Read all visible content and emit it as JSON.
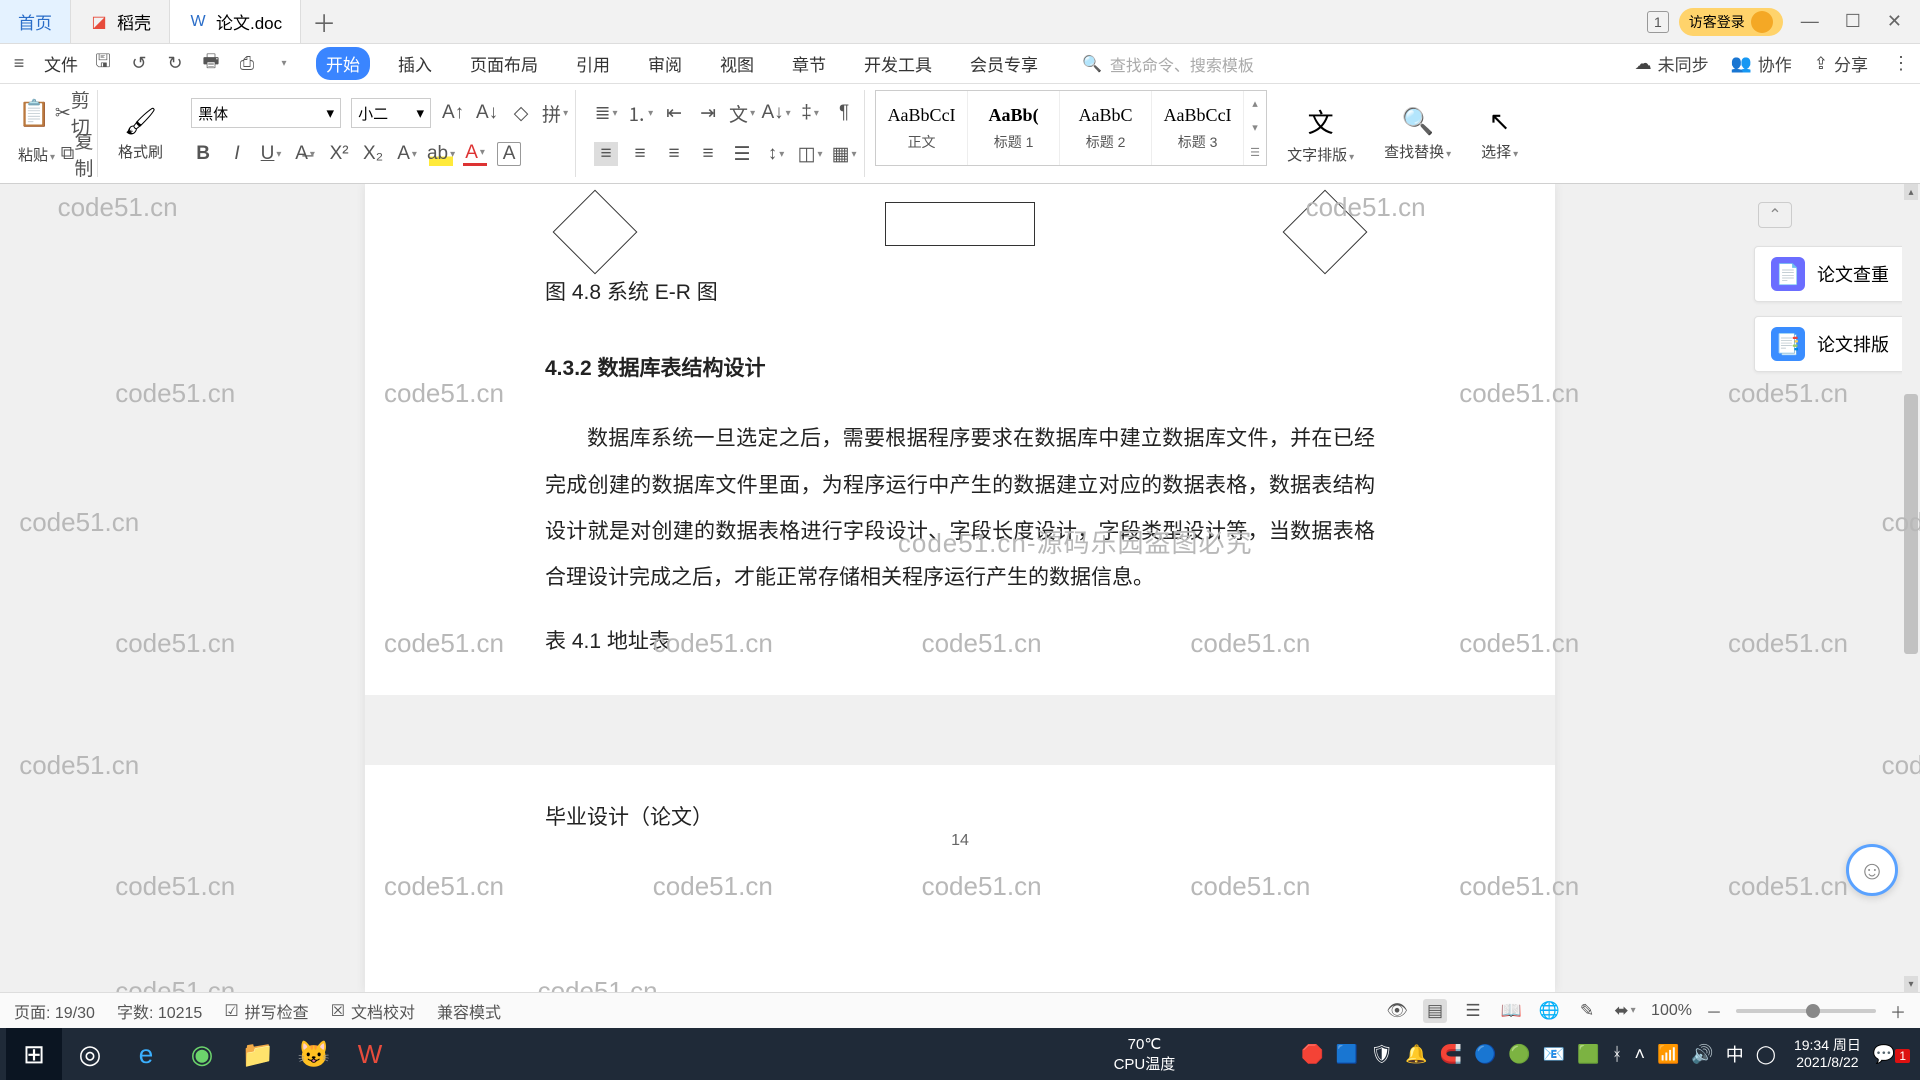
{
  "tabs": {
    "home": "首页",
    "daoke": "稻壳",
    "doc": "论文.doc"
  },
  "titlebar": {
    "num": "1",
    "login": "访客登录"
  },
  "menubar": {
    "file": "文件",
    "items": [
      "开始",
      "插入",
      "页面布局",
      "引用",
      "审阅",
      "视图",
      "章节",
      "开发工具",
      "会员专享"
    ],
    "search_placeholder": "查找命令、搜索模板",
    "unsync": "未同步",
    "coop": "协作",
    "share": "分享"
  },
  "ribbon": {
    "paste": "粘贴",
    "cut": "剪切",
    "copy": "复制",
    "format_painter": "格式刷",
    "font_name": "黑体",
    "font_size": "小二",
    "styles": [
      {
        "prev": "AaBbCcI",
        "name": "正文"
      },
      {
        "prev": "AaBb(",
        "name": "标题 1"
      },
      {
        "prev": "AaBbC",
        "name": "标题 2"
      },
      {
        "prev": "AaBbCcI",
        "name": "标题 3"
      }
    ],
    "text_layout": "文字排版",
    "find_replace": "查找替换",
    "select": "选择"
  },
  "doc": {
    "fig_caption": "图 4.8  系统 E-R 图",
    "heading": "4.3.2  数据库表结构设计",
    "para": "数据库系统一旦选定之后，需要根据程序要求在数据库中建立数据库文件，并在已经完成创建的数据库文件里面，为程序运行中产生的数据建立对应的数据表格，数据表结构设计就是对创建的数据表格进行字段设计、字段长度设计，字段类型设计等，当数据表格合理设计完成之后，才能正常存储相关程序运行产生的数据信息。",
    "table_caption": "表 4.1 地址表",
    "page_num": "14",
    "footer": "毕业设计（论文）"
  },
  "watermark": "code51.cn",
  "redmark": "code51.cn-源码乐园盗图必究",
  "side": {
    "plagiarism": "论文查重",
    "layout": "论文排版"
  },
  "status": {
    "page": "页面: 19/30",
    "words": "字数: 10215",
    "spell": "拼写检查",
    "proof": "文档校对",
    "compat": "兼容模式",
    "zoom": "100%"
  },
  "taskbar": {
    "cpu_label": "CPU温度",
    "cpu_val": "70℃",
    "time": "19:34 周日",
    "date": "2021/8/22",
    "notif": "1"
  }
}
